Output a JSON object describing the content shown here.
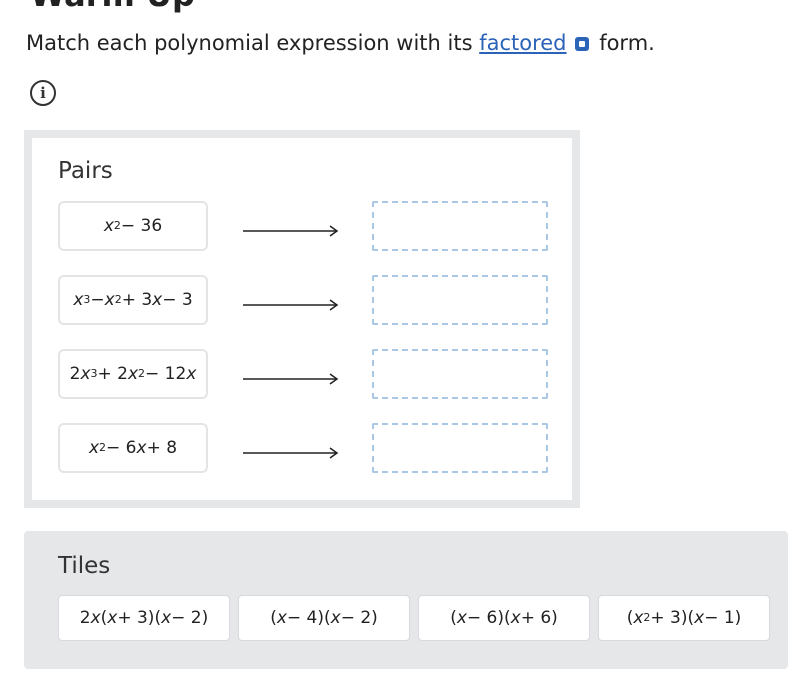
{
  "header": {
    "title": "Warm Up",
    "instructions_before": "Match each polynomial expression with its ",
    "glossary_link": "factored",
    "instructions_after": " form."
  },
  "pairs": {
    "title": "Pairs",
    "items": [
      {
        "prompt_html": "<i>x</i><sup>2</sup> − 36",
        "answer": ""
      },
      {
        "prompt_html": "<i>x</i><sup>3</sup> − <i>x</i><sup>2</sup> + 3<i>x</i> − 3",
        "answer": ""
      },
      {
        "prompt_html": "2<i>x</i><sup>3</sup> + 2<i>x</i><sup>2</sup> − 12<i>x</i>",
        "answer": ""
      },
      {
        "prompt_html": "<i>x</i><sup>2</sup> − 6<i>x</i> + 8",
        "answer": ""
      }
    ]
  },
  "tiles": {
    "title": "Tiles",
    "items": [
      {
        "label_html": "2<i>x</i>(<i>x</i> + 3)(<i>x</i> − 2)"
      },
      {
        "label_html": "(<i>x</i> − 4)(<i>x</i> − 2)"
      },
      {
        "label_html": "(<i>x</i> − 6)(<i>x</i> + 6)"
      },
      {
        "label_html": "(<i>x</i><sup>2</sup> + 3)(<i>x</i> − 1)"
      }
    ]
  },
  "icons": {
    "glossary": "external-link-icon",
    "info": "info-icon",
    "arrow": "right-arrow-icon"
  },
  "colors": {
    "link": "#2a63b8",
    "drop_zone_border": "#a8c8e6",
    "panel_border": "#e6e7e9"
  }
}
